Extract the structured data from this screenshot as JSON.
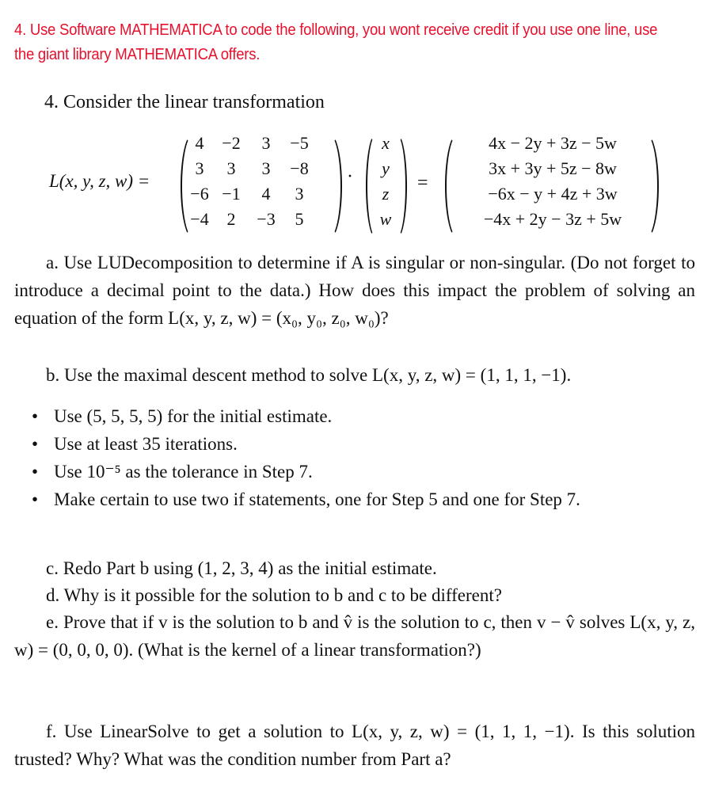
{
  "header": {
    "instruction": "4. Use Software MATHEMATICA to code the following, you wont receive credit if you use one line, use the giant library MATHEMATICA offers.",
    "color": "#e8112d"
  },
  "problem": {
    "intro": "4. Consider the linear transformation",
    "lhs": "L(x, y, z, w) =",
    "matrix": [
      [
        "4",
        "−2",
        "3",
        "−5"
      ],
      [
        "3",
        "3",
        "3",
        "−8"
      ],
      [
        "−6",
        "−1",
        "4",
        "3"
      ],
      [
        "−4",
        "2",
        "−3",
        "5"
      ]
    ],
    "vector": [
      "x",
      "y",
      "z",
      "w"
    ],
    "dot": "·",
    "equals": "=",
    "result": [
      "4x − 2y + 3z − 5w",
      "3x + 3y + 5z − 8w",
      "−6x − y + 4z + 3w",
      "−4x + 2y − 3z + 5w"
    ]
  },
  "parts": {
    "a": "a. Use LUDecomposition to determine if A is singular or non-singular. (Do not forget to introduce a decimal point to the data.) How does this impact the problem of solving an equation of the form L(x, y, z, w) = (x₀, y₀, z₀, w₀)?",
    "b": "b. Use the maximal descent method to solve L(x, y, z, w) = (1, 1, 1, −1).",
    "bullets": [
      "Use (5, 5, 5, 5) for the initial estimate.",
      "Use at least 35 iterations.",
      "Use 10⁻⁵ as the tolerance in Step 7.",
      "Make certain to use two if statements, one for Step 5 and one for Step 7."
    ],
    "c": "c. Redo Part b using (1, 2, 3, 4) as the initial estimate.",
    "d": "d. Why is it possible for the solution to b and c to be different?",
    "e": "e. Prove that if v is the solution to b and v̂ is the solution to c, then v − v̂ solves L(x, y, z, w) = (0, 0, 0, 0). (What is the kernel of a linear transformation?)",
    "f": "f. Use LinearSolve to get a solution to L(x, y, z, w) = (1, 1, 1, −1). Is this solution trusted? Why? What was the condition number from Part a?"
  }
}
